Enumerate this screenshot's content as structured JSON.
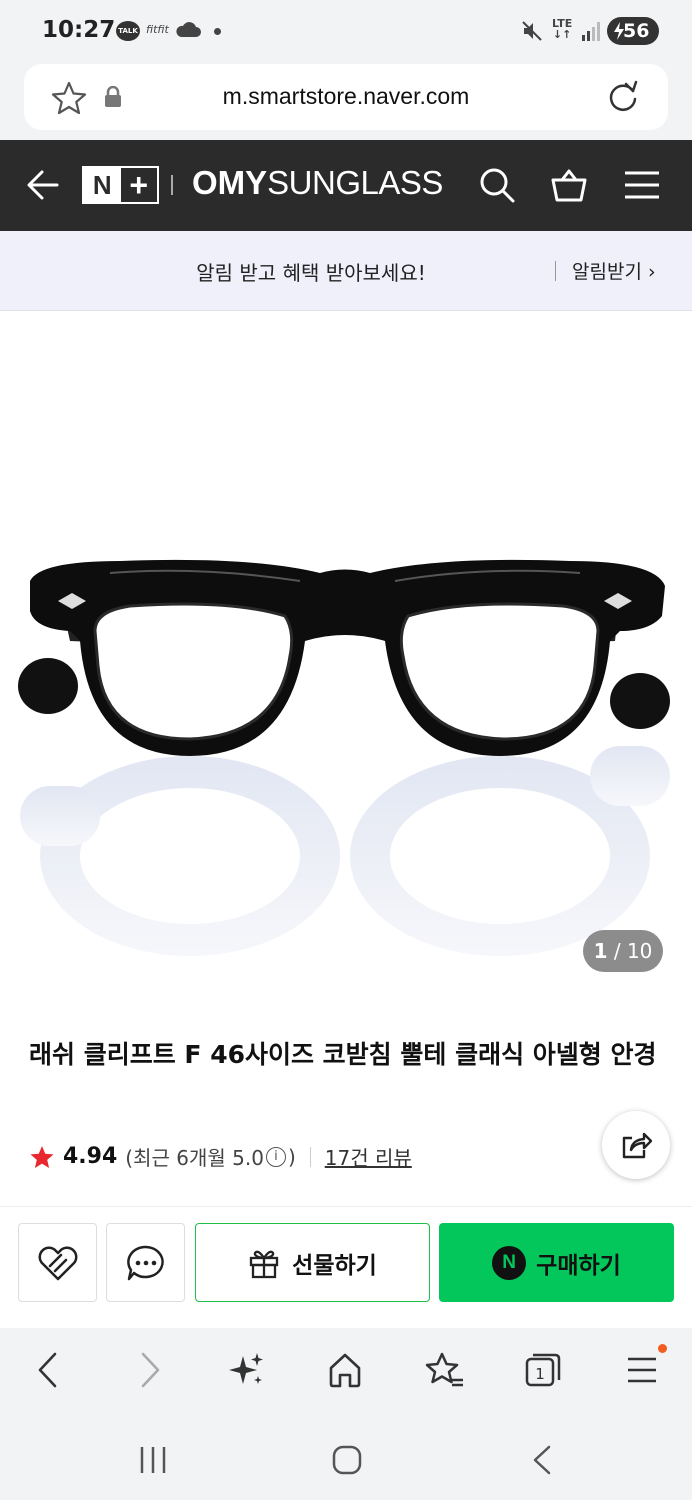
{
  "status_bar": {
    "time": "10:27",
    "talk_badge": "TALK",
    "app_badge": "fitfit",
    "network": "LTE",
    "battery": "56"
  },
  "browser": {
    "url": "m.smartstore.naver.com"
  },
  "store_header": {
    "badge_n": "N",
    "badge_plus": "+",
    "brand_bold": "OMY",
    "brand_rest": "SUNGLASS"
  },
  "notify": {
    "message": "알림 받고 혜택 받아보세요!",
    "button": "알림받기 ›"
  },
  "gallery": {
    "current": "1",
    "separator": " / ",
    "total": "10"
  },
  "product": {
    "title": "래쉬 클리프트 F 46사이즈 코받침 뿔테 클래식 아넬형 안경",
    "rating": "4.94",
    "recent_prefix": "(최근 6개월 5.0",
    "recent_suffix": ")",
    "info_mark": "i",
    "reviews": "17건 리뷰"
  },
  "actions": {
    "gift": "선물하기",
    "buy_logo": "N",
    "buy": "구매하기"
  },
  "colors": {
    "header_bg": "#2b2b2b",
    "notify_bg": "#f0f0fb",
    "naver_green": "#03c75a",
    "star": "#e8272e"
  },
  "icons": [
    "star-icon",
    "lock-icon",
    "reload-icon",
    "back-arrow-icon",
    "search-icon",
    "cart-icon",
    "hamburger-icon",
    "share-icon",
    "like-icon",
    "chat-icon",
    "gift-icon",
    "nav-back-icon",
    "nav-forward-icon",
    "ai-sparkle-icon",
    "home-icon",
    "bookmarks-icon",
    "tabs-icon",
    "menu-icon"
  ]
}
